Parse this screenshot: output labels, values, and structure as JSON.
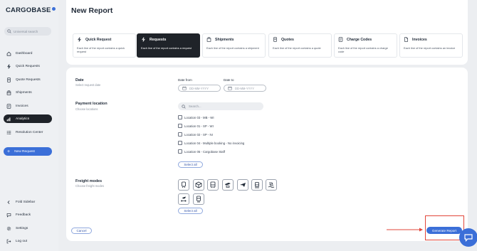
{
  "sidebar": {
    "logo": "CARGOBASE",
    "search_placeholder": "Universal search",
    "items": [
      {
        "label": "Dashboard",
        "icon": "home-icon"
      },
      {
        "label": "Quick Requests",
        "icon": "bolt-icon"
      },
      {
        "label": "Quote Requests",
        "icon": "quote-icon"
      },
      {
        "label": "Shipments",
        "icon": "package-icon"
      },
      {
        "label": "Invoices",
        "icon": "invoice-icon"
      },
      {
        "label": "Analytics",
        "icon": "analytics-icon",
        "active": true
      },
      {
        "label": "Resolution Center",
        "icon": "list-icon"
      }
    ],
    "new_request": "New Request",
    "bottom_items": [
      {
        "label": "Fold Sidebar",
        "icon": "fold-icon"
      },
      {
        "label": "Feedback",
        "icon": "chat-icon"
      },
      {
        "label": "Settings",
        "icon": "gear-icon"
      },
      {
        "label": "Log out",
        "icon": "logout-icon"
      }
    ]
  },
  "header": {
    "title": "New Report",
    "report_types": [
      {
        "label": "Quick Request",
        "desc": "Each line of the report contains a quick request",
        "icon": "bolt-icon"
      },
      {
        "label": "Requests",
        "desc": "Each line of the report contains a request",
        "icon": "bolt-icon",
        "selected": true
      },
      {
        "label": "Shipments",
        "desc": "Each line of the report contains a shipment",
        "icon": "package-icon"
      },
      {
        "label": "Quotes",
        "desc": "Each line of the report contains a quote",
        "icon": "quote-icon"
      },
      {
        "label": "Charge Codes",
        "desc": "Each line of the report contains a charge code",
        "icon": "invoice-icon"
      },
      {
        "label": "Invoices",
        "desc": "Each line of the report contains an invoice",
        "icon": "document-icon"
      }
    ]
  },
  "form": {
    "date": {
      "title": "Date",
      "subtitle": "Select request date",
      "from_label": "Date from",
      "to_label": "Date to",
      "from_placeholder": "DD-MM-YYYY",
      "to_placeholder": "DD-MM-YYYY"
    },
    "payment_location": {
      "title": "Payment location",
      "subtitle": "Choose locations",
      "search_placeholder": "Search...",
      "locations": [
        "Location 03 - MB - WI",
        "Location 01 - SP - WI",
        "Location 02 - SP - NI",
        "Location 04 - Multiple booking - No invoicing",
        "Location 05 - Cargobase Staff"
      ],
      "select_all": "Select all"
    },
    "freight_modes": {
      "title": "Freight modes",
      "subtitle": "Choose freight modes",
      "modes": [
        "train-icon",
        "box-icon",
        "bus-icon",
        "plane-truck-icon",
        "plane-icon",
        "truck-icon",
        "ship-icon",
        "flight-connect-icon",
        "rail-icon"
      ],
      "select_all": "Select all"
    },
    "cancel": "Cancel",
    "generate": "Generate Report"
  },
  "colors": {
    "accent": "#3b6fd8",
    "dark": "#1f2329",
    "highlight": "#e2463a"
  }
}
